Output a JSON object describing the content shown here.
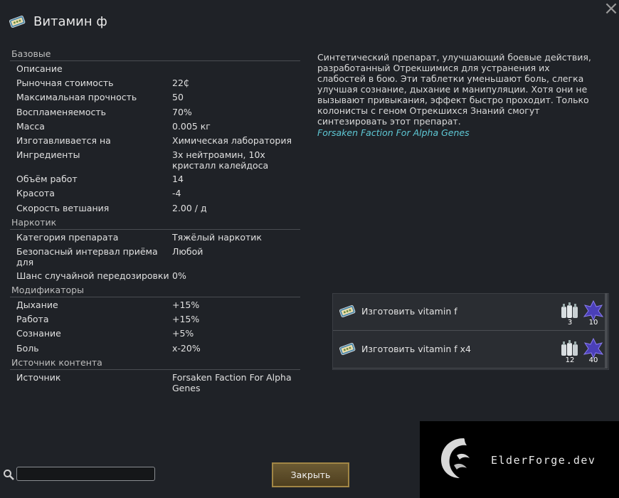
{
  "window": {
    "title": "Витамин ф",
    "close_icon": "close-x-icon"
  },
  "stats": {
    "sections": [
      {
        "header": "Базовые",
        "rows": [
          {
            "key": "Описание",
            "value": ""
          },
          {
            "key": "Рыночная стоимость",
            "value": "22₵"
          },
          {
            "key": "Максимальная прочность",
            "value": "50"
          },
          {
            "key": "Воспламеняемость",
            "value": "70%"
          },
          {
            "key": "Масса",
            "value": "0.005 кг"
          },
          {
            "key": "Изготавливается на",
            "value": "Химическая лаборатория"
          },
          {
            "key": "Ингредиенты",
            "value": "3x нейтроамин, 10x кристалл калейдоса"
          },
          {
            "key": "Объём работ",
            "value": "14"
          },
          {
            "key": "Красота",
            "value": "-4"
          },
          {
            "key": "Скорость ветшания",
            "value": "2.00 / д"
          }
        ]
      },
      {
        "header": "Наркотик",
        "rows": [
          {
            "key": "Категория препарата",
            "value": "Тяжёлый наркотик"
          },
          {
            "key": "Безопасный интервал приёма для",
            "value": "Любой"
          },
          {
            "key": "Шанс случайной передозировки",
            "value": "0%"
          }
        ]
      },
      {
        "header": "Модификаторы",
        "rows": [
          {
            "key": "Дыхание",
            "value": "+15%"
          },
          {
            "key": "Работа",
            "value": "+15%"
          },
          {
            "key": "Сознание",
            "value": "+5%"
          },
          {
            "key": "Боль",
            "value": "x-20%"
          }
        ]
      },
      {
        "header": "Источник контента",
        "rows": [
          {
            "key": "Источник",
            "value": "Forsaken Faction For Alpha Genes"
          }
        ]
      }
    ]
  },
  "description": "Синтетический препарат, улучшающий боевые действия, разработанный Отрекшимися для устранения их слабостей в бою. Эти таблетки уменьшают боль, слегка улучшая сознание, дыхание и манипуляции. Хотя они не вызывают привыкания, эффект быстро проходит. Только колонисты с геном Отрекшихся Знаний смогут синтезировать этот препарат.",
  "source_link": "Forsaken Faction For Alpha Genes",
  "recipes": [
    {
      "label": "Изготовить vitamin f",
      "neutroamine_count": "3",
      "crystal_count": "10"
    },
    {
      "label": "Изготовить vitamin f x4",
      "neutroamine_count": "12",
      "crystal_count": "40"
    }
  ],
  "search": {
    "placeholder": "",
    "value": ""
  },
  "footer": {
    "close_label": "Закрыть"
  },
  "watermark": {
    "text": "ElderForge.dev"
  },
  "colors": {
    "link": "#5fc9d6",
    "button_border": "#a18645",
    "background": "#1f2227"
  }
}
